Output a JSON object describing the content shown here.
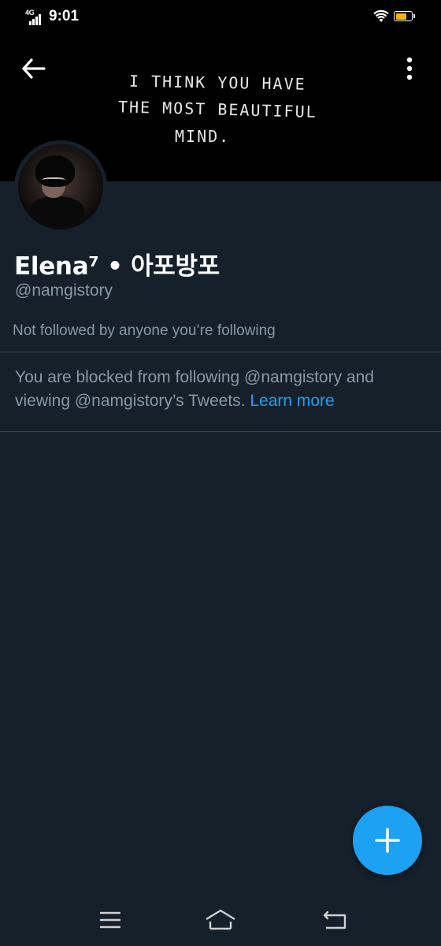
{
  "status_bar": {
    "network": "4G",
    "time": "9:01",
    "battery_color": "#f4b400"
  },
  "header": {
    "banner_text": {
      "line1": "I THINK YOU HAVE",
      "line2": "THE MOST BEAUTIFUL",
      "line3": "MIND."
    },
    "back_icon": "back-arrow-icon",
    "more_icon": "vertical-dots-icon"
  },
  "profile": {
    "display_name": "Elena⁷ • 아포방포",
    "username": "@namgistory",
    "followed_by": "Not followed by anyone you’re following",
    "blocked_message": "You are blocked from following @namgistory and viewing @namgistory’s Tweets.",
    "learn_more": "Learn more"
  },
  "fab": {
    "icon": "plus-icon",
    "color": "#1da1f2"
  },
  "nav_bar": {
    "icons": [
      "menu-icon",
      "home-icon",
      "back-icon"
    ]
  },
  "colors": {
    "background": "#15202b",
    "secondary_text": "#8899a6",
    "accent": "#1da1f2",
    "divider": "#38444d"
  }
}
